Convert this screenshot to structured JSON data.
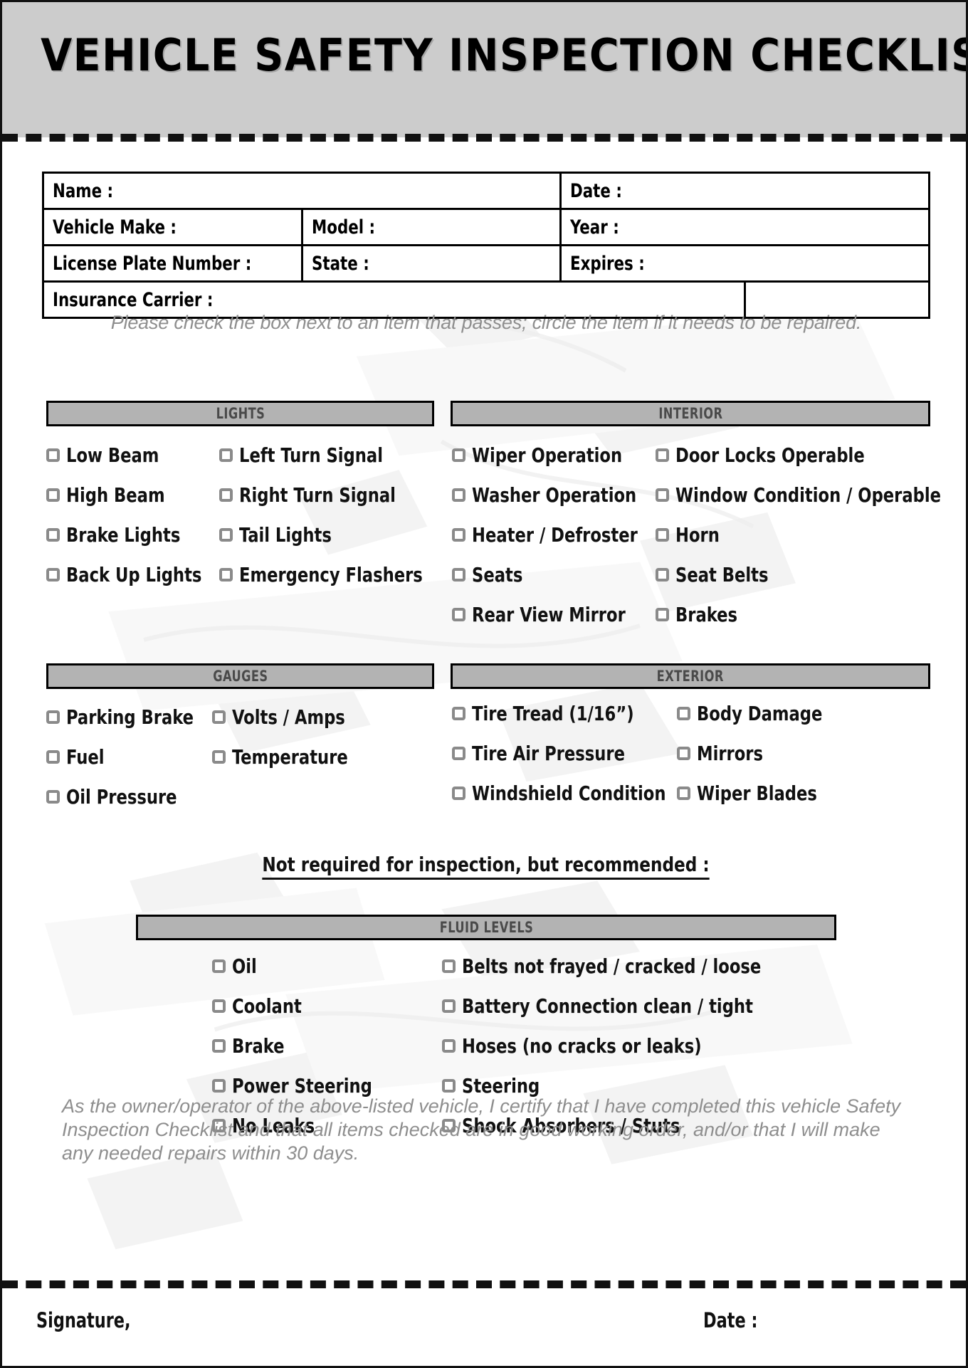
{
  "document": {
    "title": "VEHICLE SAFETY INSPECTION CHECKLIST"
  },
  "colors": {
    "header_band": "#cccccc",
    "section_header_bg": "#b3b3b3",
    "section_header_text": "#4a4a4a",
    "checkbox_border": "#8a8a8a",
    "muted_text": "#8e8e8e",
    "rule": "#111111"
  },
  "info_fields": {
    "row1": {
      "name": "Name :",
      "date": "Date :"
    },
    "row2": {
      "make": "Vehicle Make :",
      "model": "Model :",
      "year": "Year :"
    },
    "row3": {
      "plate": "License Plate Number :",
      "state": "State :",
      "expires": "Expires :"
    },
    "row4": {
      "insurance": "Insurance Carrier :",
      "blank": ""
    }
  },
  "instructions": "Please check the box next to an item that passes; circle the item if it needs to be repaired.",
  "sections": [
    {
      "id": "lights",
      "title": "LIGHTS",
      "col1": [
        "Low Beam",
        "High Beam",
        "Brake Lights",
        "Back Up Lights"
      ],
      "col2": [
        "Left Turn Signal",
        "Right Turn Signal",
        "Tail Lights",
        "Emergency Flashers"
      ]
    },
    {
      "id": "interior",
      "title": "INTERIOR",
      "col1": [
        "Wiper Operation",
        "Washer Operation",
        "Heater / Defroster",
        "Seats",
        "Rear View Mirror"
      ],
      "col2": [
        "Door Locks Operable",
        "Window Condition / Operable",
        "Horn",
        "Seat Belts",
        "Brakes"
      ]
    },
    {
      "id": "gauges",
      "title": "GAUGES",
      "col1": [
        "Parking Brake",
        "Fuel",
        "Oil Pressure"
      ],
      "col2": [
        "Volts / Amps",
        "Temperature"
      ]
    },
    {
      "id": "exterior",
      "title": "EXTERIOR",
      "col1": [
        "Tire Tread (1/16”)",
        "Tire Air Pressure",
        "Windshield Condition"
      ],
      "col2": [
        "Body Damage",
        "Mirrors",
        "Wiper Blades"
      ]
    }
  ],
  "recommended_heading": "Not required for inspection, but recommended :",
  "fluid_levels": {
    "title": "FLUID LEVELS",
    "col1": [
      "Oil",
      "Coolant",
      "Brake",
      "Power Steering",
      "No Leaks"
    ],
    "col2": [
      "Belts not frayed / cracked / loose",
      "Battery Connection clean / tight",
      "Hoses (no cracks or leaks)",
      "Steering",
      "Shock Absorbers / Stuts"
    ]
  },
  "certification": "As the owner/operator of the above-listed vehicle, I certify that I have completed this vehicle Safety Inspection Checklist and that all items checked are in good working order, and/or that I will make any needed repairs within 30 days.",
  "footer": {
    "signature_label": "Signature,",
    "date_label": "Date :"
  }
}
